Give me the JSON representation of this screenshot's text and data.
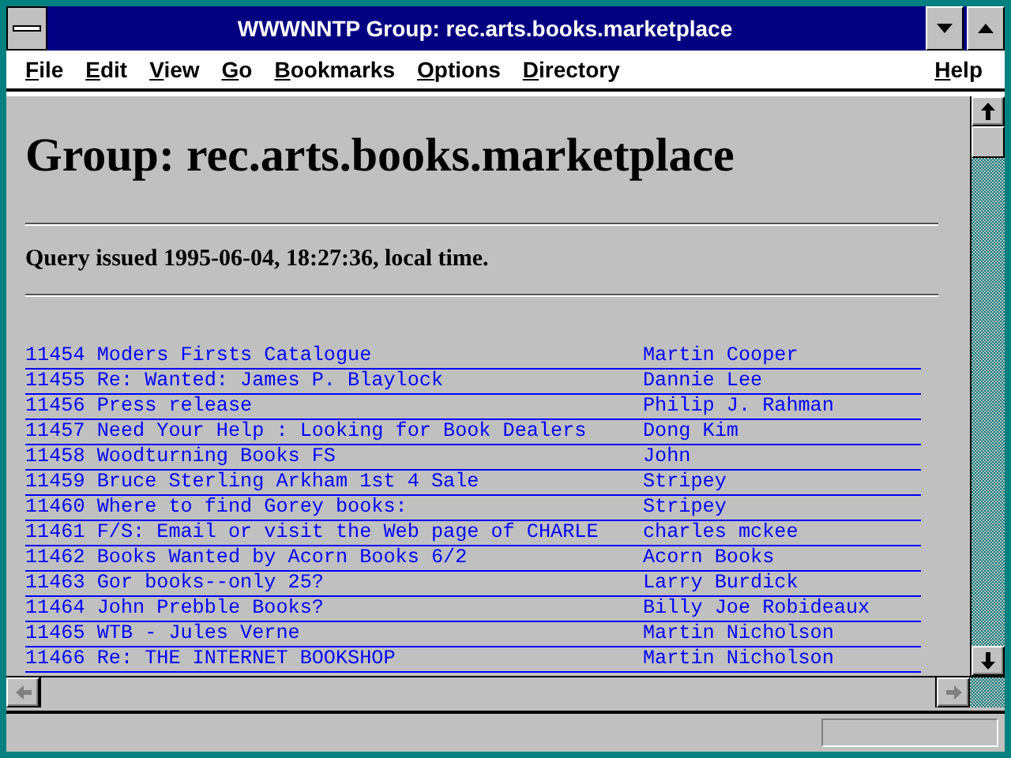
{
  "window": {
    "title": "WWWNNTP Group: rec.arts.books.marketplace"
  },
  "menu": {
    "left": [
      "File",
      "Edit",
      "View",
      "Go",
      "Bookmarks",
      "Options",
      "Directory"
    ],
    "right": [
      "Help"
    ]
  },
  "page": {
    "heading": "Group: rec.arts.books.marketplace",
    "query": "Query issued 1995-06-04, 18:27:36, local time.",
    "articles": [
      {
        "number": "11454",
        "subject": "Moders Firsts Catalogue",
        "author": "Martin Cooper"
      },
      {
        "number": "11455",
        "subject": "Re: Wanted: James P. Blaylock",
        "author": "Dannie Lee"
      },
      {
        "number": "11456",
        "subject": "Press release",
        "author": "Philip J. Rahman"
      },
      {
        "number": "11457",
        "subject": "Need Your Help : Looking for Book Dealers",
        "author": "Dong Kim"
      },
      {
        "number": "11458",
        "subject": "Woodturning Books FS",
        "author": "John"
      },
      {
        "number": "11459",
        "subject": "Bruce Sterling Arkham 1st 4 Sale",
        "author": "Stripey"
      },
      {
        "number": "11460",
        "subject": "Where to find Gorey books:",
        "author": "Stripey"
      },
      {
        "number": "11461",
        "subject": "F/S: Email or visit the Web page of CHARLE",
        "author": "charles mckee"
      },
      {
        "number": "11462",
        "subject": "Books Wanted by Acorn Books 6/2",
        "author": "Acorn Books"
      },
      {
        "number": "11463",
        "subject": "Gor books--only 25?",
        "author": "Larry Burdick"
      },
      {
        "number": "11464",
        "subject": "John Prebble Books?",
        "author": "Billy Joe Robideaux"
      },
      {
        "number": "11465",
        "subject": "WTB - Jules Verne",
        "author": "Martin Nicholson"
      },
      {
        "number": "11466",
        "subject": "Re: THE INTERNET BOOKSHOP",
        "author": "Martin Nicholson"
      }
    ]
  }
}
